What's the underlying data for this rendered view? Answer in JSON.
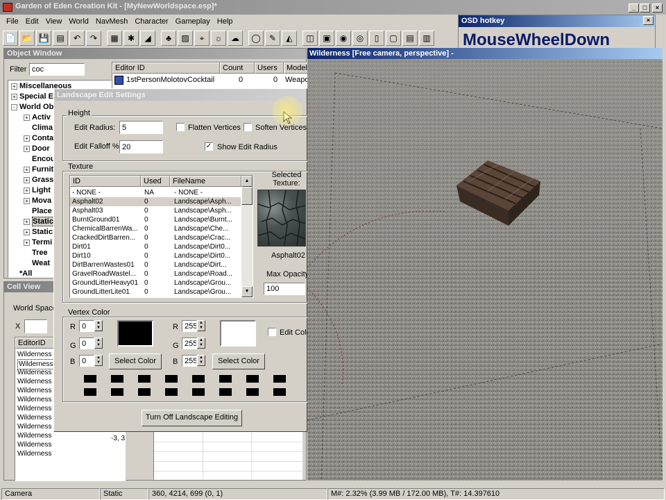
{
  "app": {
    "title": "Garden of Eden Creation Kit - [MyNewWorldspace.esp]*"
  },
  "menu": [
    "File",
    "Edit",
    "View",
    "World",
    "NavMesh",
    "Character",
    "Gameplay",
    "Help"
  ],
  "toolbar_icons": [
    "new-icon",
    "open-icon",
    "save-icon",
    "save-as-icon",
    "undo-icon",
    "redo-icon",
    "sep",
    "grid-icon",
    "snap-icon",
    "angle-icon",
    "sep",
    "tree-icon",
    "landscape-icon",
    "marker-icon",
    "light-icon",
    "sky-icon",
    "sep",
    "speech-icon",
    "pencil-icon",
    "navmesh-icon",
    "sep",
    "box1-icon",
    "box2-icon",
    "box3-icon",
    "box4-icon",
    "box5-icon",
    "box6-icon",
    "box7-icon",
    "box8-icon"
  ],
  "osd": {
    "title": "OSD hotkey",
    "text": "MouseWheelDown"
  },
  "object_window": {
    "title": "Object Window",
    "filter_label": "Filter",
    "filter_value": "coc",
    "tree": [
      {
        "label": "Miscellaneous",
        "indent": 0,
        "expander": "+",
        "bold": true
      },
      {
        "label": "Special E",
        "indent": 0,
        "expander": "+",
        "bold": true
      },
      {
        "label": "World Ob",
        "indent": 0,
        "expander": "-",
        "bold": true
      },
      {
        "label": "Activ",
        "indent": 1,
        "expander": "+",
        "bold": true
      },
      {
        "label": "Clima",
        "indent": 1,
        "expander": "",
        "bold": true
      },
      {
        "label": "Conta",
        "indent": 1,
        "expander": "+",
        "bold": true
      },
      {
        "label": "Door",
        "indent": 1,
        "expander": "+",
        "bold": true
      },
      {
        "label": "Encou",
        "indent": 1,
        "expander": "",
        "bold": true
      },
      {
        "label": "Furnit",
        "indent": 1,
        "expander": "+",
        "bold": true
      },
      {
        "label": "Grass",
        "indent": 1,
        "expander": "+",
        "bold": true
      },
      {
        "label": "Light",
        "indent": 1,
        "expander": "+",
        "bold": true
      },
      {
        "label": "Mova",
        "indent": 1,
        "expander": "+",
        "bold": true
      },
      {
        "label": "Place",
        "indent": 1,
        "expander": "",
        "bold": true
      },
      {
        "label": "Static",
        "indent": 1,
        "expander": "+",
        "bold": true,
        "selected": true
      },
      {
        "label": "Static",
        "indent": 1,
        "expander": "+",
        "bold": true
      },
      {
        "label": "Termi",
        "indent": 1,
        "expander": "+",
        "bold": true
      },
      {
        "label": "Tree",
        "indent": 1,
        "expander": "",
        "bold": true
      },
      {
        "label": "Weat",
        "indent": 1,
        "expander": "",
        "bold": true
      },
      {
        "label": "*All",
        "indent": 0,
        "expander": "",
        "bold": true
      }
    ],
    "columns": [
      "Editor ID",
      "Count",
      "Users",
      "Model"
    ],
    "rows": [
      {
        "editor_id": "1stPersonMolotovCocktail",
        "count": "0",
        "users": "0",
        "model": "Weapo"
      }
    ]
  },
  "cell_view": {
    "title": "Cell View",
    "worldspace_label": "World Space",
    "x_label": "X",
    "column": "EditorID",
    "rows": [
      "Wilderness",
      "Wilderness",
      "Wilderness",
      "Wilderness",
      "Wilderness",
      "Wilderness",
      "Wilderness",
      "Wilderness",
      "Wilderness",
      "Wilderness",
      "Wilderness",
      "Wilderness"
    ],
    "coord_partial": "-3, 3"
  },
  "landscape": {
    "title": "Landscape Edit Settings",
    "height_group": "Height",
    "edit_radius_label": "Edit Radius:",
    "edit_radius": "5",
    "edit_falloff_label": "Edit Falloff %:",
    "edit_falloff": "20",
    "flatten_label": "Flatten Vertices",
    "soften_label": "Soften Vertices",
    "show_radius_label": "Show Edit Radius",
    "texture_group": "Texture",
    "tex_columns": [
      "ID",
      "Used",
      "FileName"
    ],
    "textures": [
      {
        "id": "- NONE -",
        "used": "NA",
        "file": "- NONE -"
      },
      {
        "id": "Asphalt02",
        "used": "0",
        "file": "Landscape\\Asph..."
      },
      {
        "id": "Asphalt03",
        "used": "0",
        "file": "Landscape\\Asph..."
      },
      {
        "id": "BurntGround01",
        "used": "0",
        "file": "Landscape\\Burnt..."
      },
      {
        "id": "ChemicalBarrenWa...",
        "used": "0",
        "file": "Landscape\\Che..."
      },
      {
        "id": "CrackedDirtBarren...",
        "used": "0",
        "file": "Landscape\\Crac..."
      },
      {
        "id": "Dirt01",
        "used": "0",
        "file": "Landscape\\Dirt0..."
      },
      {
        "id": "Dirt10",
        "used": "0",
        "file": "Landscape\\Dirt0..."
      },
      {
        "id": "DirtBarrenWastes01",
        "used": "0",
        "file": "Landscape\\Dirt..."
      },
      {
        "id": "GravelRoadWastel...",
        "used": "0",
        "file": "Landscape\\Road..."
      },
      {
        "id": "GroundLitterHeavy01",
        "used": "0",
        "file": "Landscape\\Grou..."
      },
      {
        "id": "GroundLitterLite01",
        "used": "0",
        "file": "Landscape\\Grou..."
      }
    ],
    "selected_texture_label": "Selected Texture:",
    "selected_texture": "Asphalt02",
    "max_opacity_label": "Max Opacity",
    "max_opacity": "100",
    "vertex_group": "Vertex Color",
    "r_label": "R",
    "g_label": "G",
    "b_label": "B",
    "left_r": "0",
    "left_g": "0",
    "left_b": "0",
    "right_r": "255",
    "right_g": "255",
    "right_b": "255",
    "select_color_label": "Select Color",
    "edit_color_label": "Edit Colo",
    "turn_off_label": "Turn Off Landscape Editing"
  },
  "viewport": {
    "title": "Wilderness [Free camera, perspective] -"
  },
  "status": {
    "mode": "Camera",
    "object": "Static",
    "coords": "360, 4214, 699 (0, 1)",
    "memory": "M#: 2.32% (3.99 MB / 172.00 MB), T#: 14.397610"
  }
}
